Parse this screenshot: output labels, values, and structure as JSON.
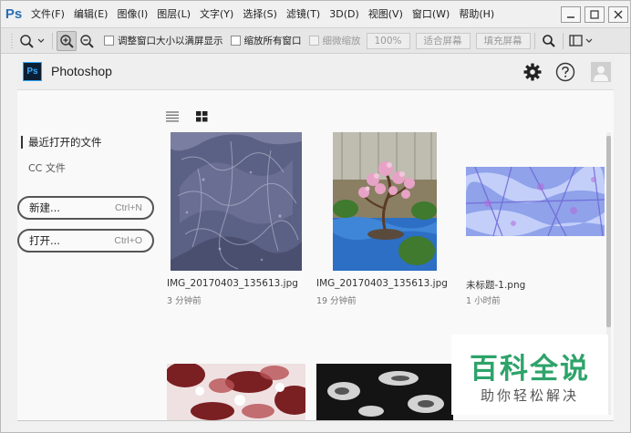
{
  "menubar": {
    "logo": "Ps",
    "items": [
      "文件(F)",
      "编辑(E)",
      "图像(I)",
      "图层(L)",
      "文字(Y)",
      "选择(S)",
      "滤镜(T)",
      "3D(D)",
      "视图(V)",
      "窗口(W)",
      "帮助(H)"
    ]
  },
  "options": {
    "resize_windows": "调整窗口大小以满屏显示",
    "zoom_all": "缩放所有窗口",
    "scrubby_zoom": "细微缩放",
    "zoom_100": "100%",
    "fit_screen": "适合屏幕",
    "fill_screen": "填充屏幕"
  },
  "header": {
    "icon_text": "Ps",
    "title": "Photoshop"
  },
  "sidebar": {
    "recent": "最近打开的文件",
    "cc_files": "CC 文件",
    "new_label": "新建...",
    "new_shortcut": "Ctrl+N",
    "open_label": "打开...",
    "open_shortcut": "Ctrl+O"
  },
  "files": [
    {
      "name": "IMG_20170403_135613.jpg",
      "time": "3 分钟前"
    },
    {
      "name": "IMG_20170403_135613.jpg",
      "time": "19 分钟前"
    },
    {
      "name": "未标题-1.png",
      "time": "1 小时前"
    }
  ],
  "watermark": {
    "title": "百科全说",
    "subtitle": "助你轻松解决"
  },
  "colors": {
    "ps_blue": "#2a6eb3",
    "ps_icon_bg": "#0a1f33",
    "ps_icon_fg": "#39a9ff",
    "watermark_green": "#2ea36a"
  }
}
